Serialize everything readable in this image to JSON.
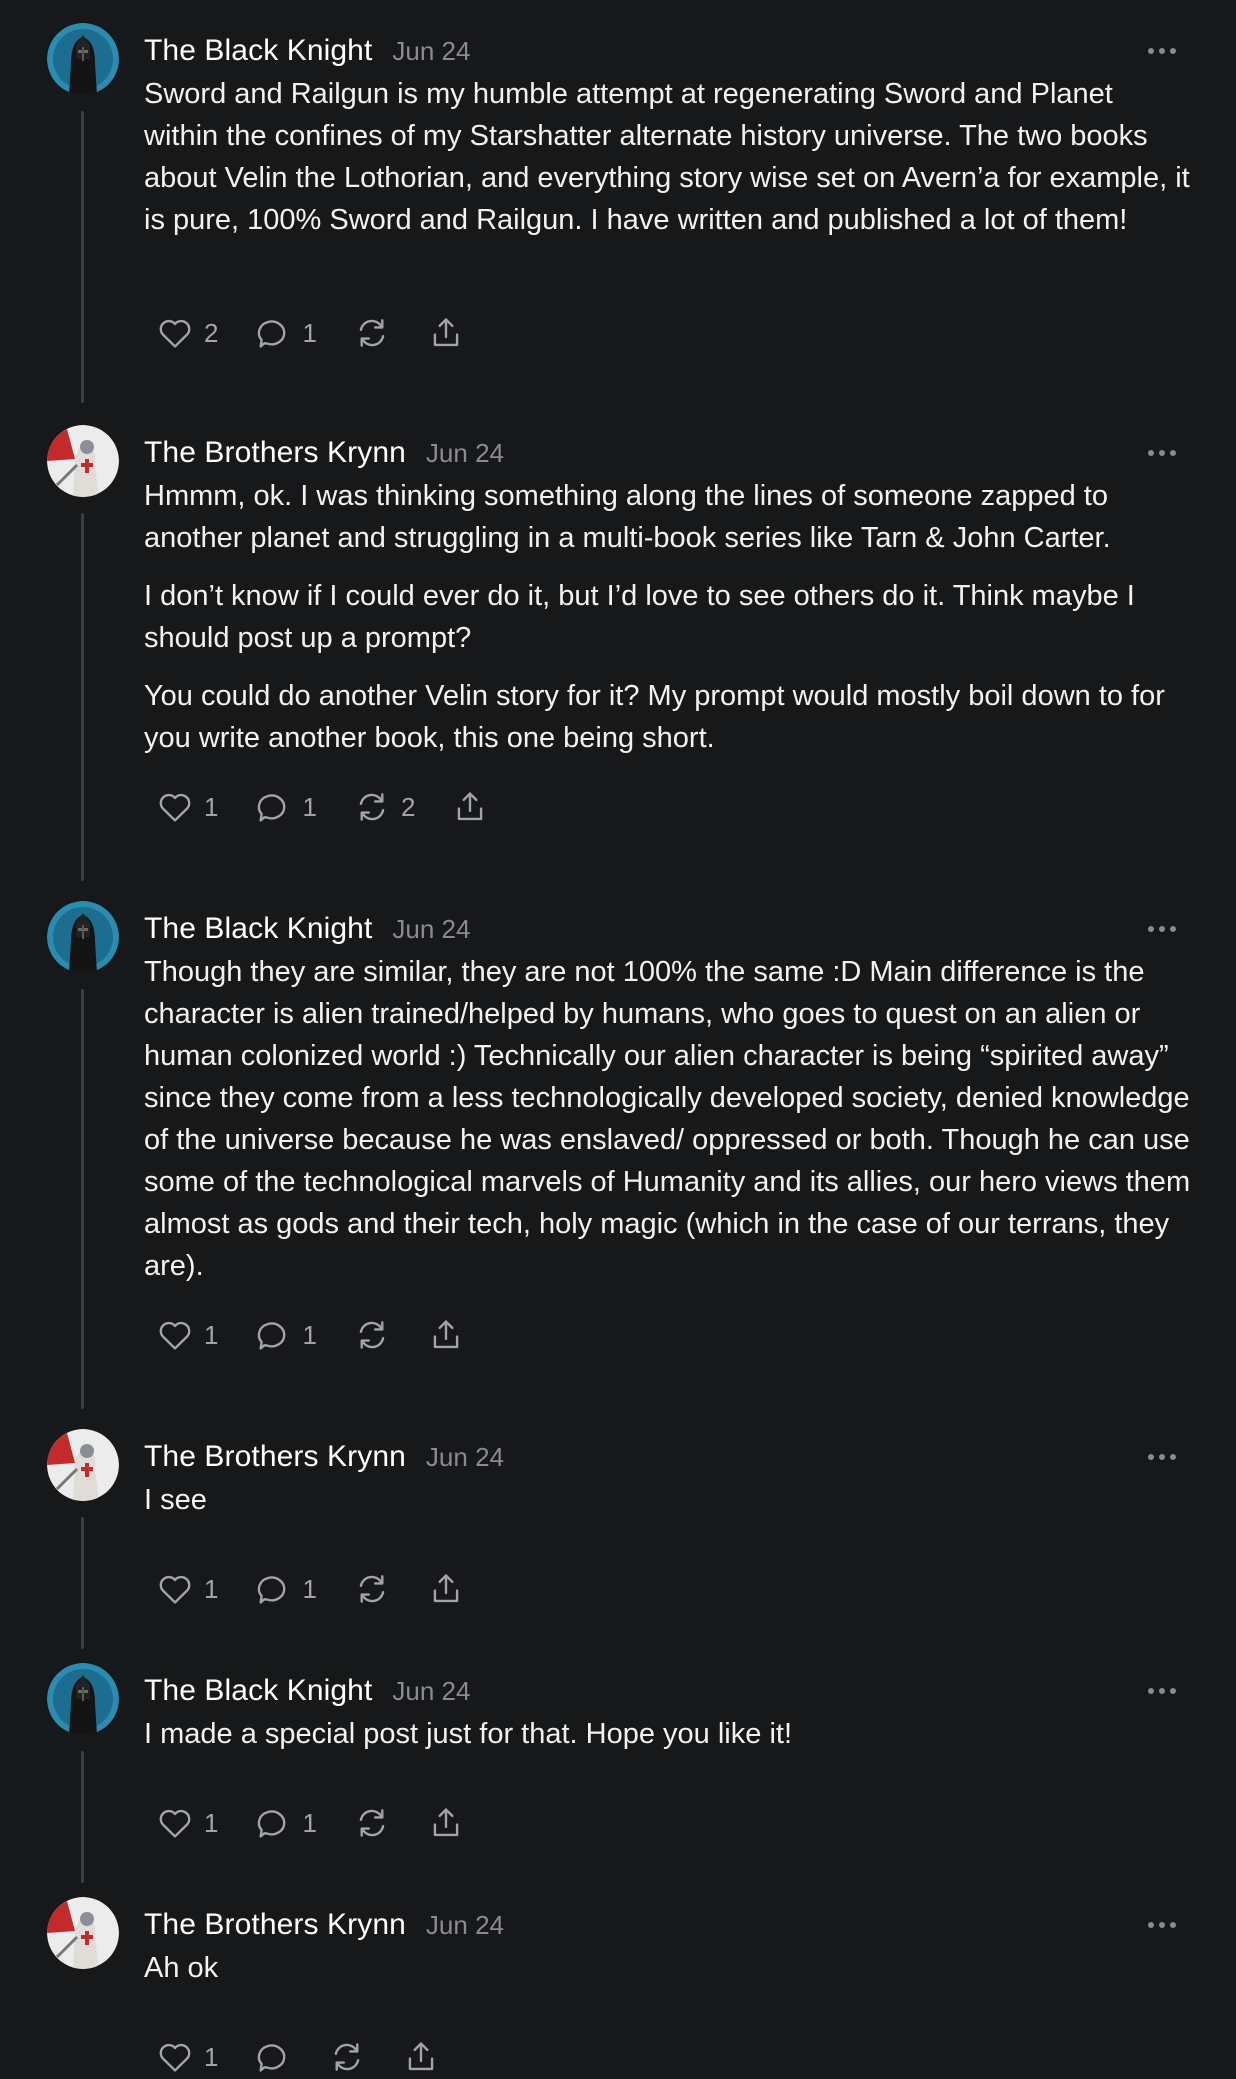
{
  "comments": [
    {
      "author": "The Black Knight",
      "date": "Jun 24",
      "avatar": "black-knight-avatar",
      "paragraphs": [
        "Sword and Railgun is my humble attempt at regenerating Sword and Planet within the confines of my Starshatter alternate history universe. The two books about Velin the Lothorian, and everything story wise set on Avern’a for example, it is pure, 100% Sword and Railgun. I have written and published a lot of them!"
      ],
      "likes": "2",
      "replies": "1",
      "restacks": ""
    },
    {
      "author": "The Brothers Krynn",
      "date": "Jun 24",
      "avatar": "brothers-krynn-avatar",
      "paragraphs": [
        "Hmmm, ok. I was thinking something along the lines of someone zapped to another planet and struggling in a multi-book series like Tarn & John Carter.",
        "I don’t know if I could ever do it, but I’d love to see others do it. Think maybe I should post up a prompt?",
        "You could do another Velin story for it? My prompt would mostly boil down to for you write another book, this one being short."
      ],
      "likes": "1",
      "replies": "1",
      "restacks": "2"
    },
    {
      "author": "The Black Knight",
      "date": "Jun 24",
      "avatar": "black-knight-avatar",
      "paragraphs": [
        "Though they are similar, they are not 100% the same :D Main difference is the character is alien trained/helped by humans, who goes to quest on an alien or human colonized world :) Technically our alien character is being “spirited away” since they come from a less technologically developed society, denied knowledge of the universe because he was enslaved/ oppressed or both. Though he can use some of the technological marvels of Humanity and its allies, our hero views them almost as gods and their tech, holy magic (which in the case of our terrans, they are)."
      ],
      "likes": "1",
      "replies": "1",
      "restacks": ""
    },
    {
      "author": "The Brothers Krynn",
      "date": "Jun 24",
      "avatar": "brothers-krynn-avatar",
      "paragraphs": [
        "I see"
      ],
      "likes": "1",
      "replies": "1",
      "restacks": ""
    },
    {
      "author": "The Black Knight",
      "date": "Jun 24",
      "avatar": "black-knight-avatar",
      "paragraphs": [
        "I made a special post just for that. Hope you like it!"
      ],
      "likes": "1",
      "replies": "1",
      "restacks": ""
    },
    {
      "author": "The Brothers Krynn",
      "date": "Jun 24",
      "avatar": "brothers-krynn-avatar",
      "paragraphs": [
        "Ah ok"
      ],
      "likes": "1",
      "replies": "",
      "restacks": ""
    }
  ],
  "icons": {
    "like": "heart-icon",
    "reply": "comment-bubble-icon",
    "restack": "restack-icon",
    "share": "share-icon",
    "more": "more-options-icon"
  },
  "colors": {
    "background": "#17181a",
    "text": "#f2f2f2",
    "muted": "#8a8b8f",
    "thread_line": "#3c3d40"
  }
}
